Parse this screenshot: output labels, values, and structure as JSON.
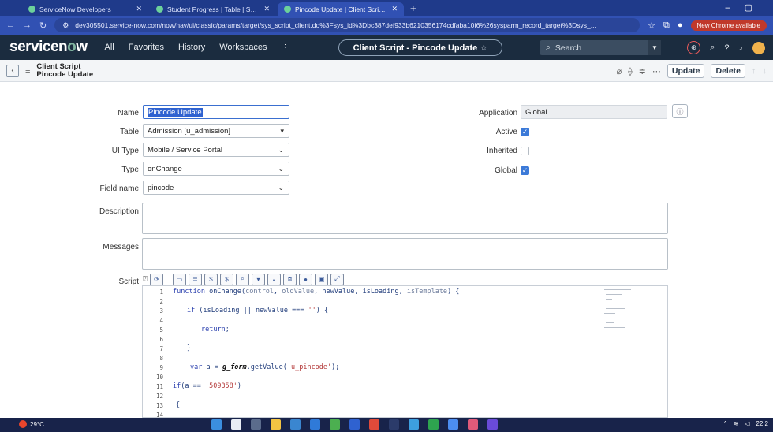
{
  "browser": {
    "tabs": [
      {
        "title": "ServiceNow Developers",
        "active": false
      },
      {
        "title": "Student Progress | Table | Servi",
        "active": false
      },
      {
        "title": "Pincode Update | Client Script |",
        "active": true
      }
    ],
    "new_tab": "+",
    "url": "dev305501.service-now.com/now/nav/ui/classic/params/target/sys_script_client.do%3Fsys_id%3Dbc387def933b6210356174cdfaba10f6%26sysparm_record_target%3Dsys_...",
    "chrome_notice": "New Chrome available"
  },
  "header": {
    "logo_pre": "servicen",
    "logo_o": "o",
    "logo_post": "w",
    "nav": [
      "All",
      "Favorites",
      "History",
      "Workspaces"
    ],
    "context_title": "Client Script - Pincode Update",
    "context_star": "☆",
    "search_placeholder": "Search"
  },
  "form_header": {
    "line1": "Client Script",
    "line2": "Pincode Update",
    "update_label": "Update",
    "delete_label": "Delete"
  },
  "form": {
    "name_label": "Name",
    "name_value": "Pincode Update",
    "table_label": "Table",
    "table_value": "Admission [u_admission]",
    "uitype_label": "UI Type",
    "uitype_value": "Mobile / Service Portal",
    "type_label": "Type",
    "type_value": "onChange",
    "fieldname_label": "Field name",
    "fieldname_value": "pincode",
    "application_label": "Application",
    "application_value": "Global",
    "active_label": "Active",
    "active_checked": true,
    "inherited_label": "Inherited",
    "inherited_checked": false,
    "global_label": "Global",
    "global_checked": true,
    "description_label": "Description",
    "messages_label": "Messages",
    "script_label": "Script"
  },
  "script": {
    "line_numbers": [
      "1",
      "2",
      "3",
      "4",
      "5",
      "6",
      "7",
      "8",
      "9",
      "10",
      "11",
      "12",
      "13",
      "14"
    ]
  },
  "taskbar": {
    "weather": "29°C",
    "time": "22:2"
  },
  "colors": {
    "sn_header": "#1b2c3f",
    "browser": "#3151b3",
    "accent": "#3c7ad8"
  }
}
